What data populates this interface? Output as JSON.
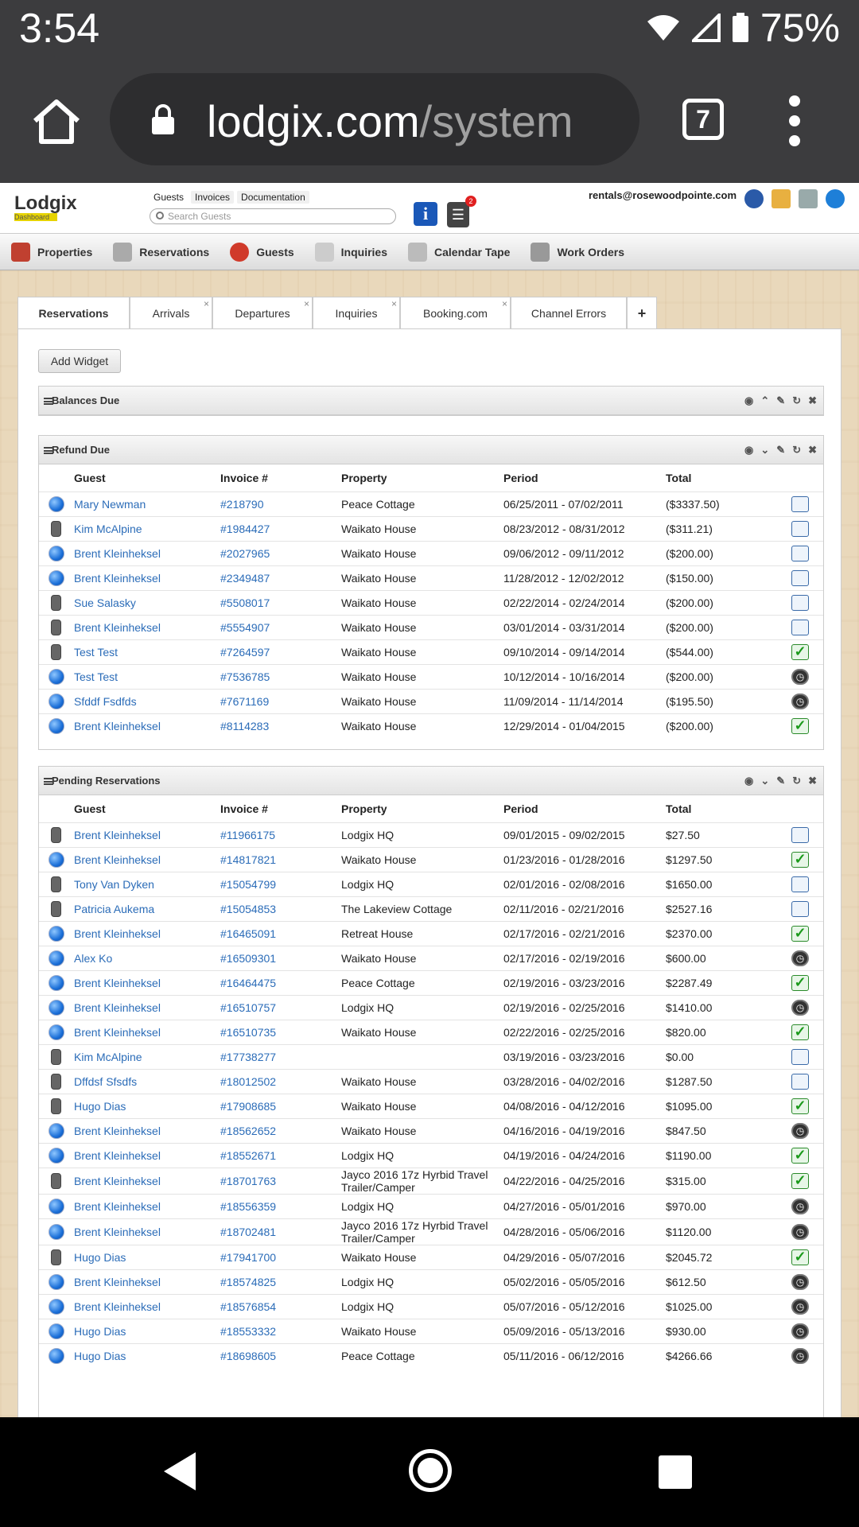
{
  "status": {
    "time": "3:54",
    "battery": "75%"
  },
  "browser": {
    "url_host": "lodgix.com",
    "url_path": "/system",
    "tab_count": "7"
  },
  "header": {
    "logo": "Lodgix",
    "logo_sub": "Dashboard",
    "links": [
      "Guests",
      "Invoices",
      "Documentation"
    ],
    "search_placeholder": "Search Guests",
    "notification_count": "2",
    "email": "rentals@rosewoodpointe.com"
  },
  "nav": [
    "Properties",
    "Reservations",
    "Guests",
    "Inquiries",
    "Calendar Tape",
    "Work Orders"
  ],
  "tabs": [
    "Reservations",
    "Arrivals",
    "Departures",
    "Inquiries",
    "Booking.com",
    "Channel Errors",
    "+"
  ],
  "add_widget": "Add Widget",
  "balances_due": {
    "title": "Balances Due"
  },
  "refund_due": {
    "title": "Refund Due",
    "columns": [
      "Guest",
      "Invoice #",
      "Property",
      "Period",
      "Total"
    ],
    "rows": [
      {
        "device": "globe",
        "guest": "Mary Newman",
        "invoice": "#218790",
        "property": "Peace Cottage",
        "period": "06/25/2011 - 07/02/2011",
        "total": "($3337.50)",
        "action": "edit"
      },
      {
        "device": "phone",
        "guest": "Kim McAlpine",
        "invoice": "#1984427",
        "property": "Waikato House",
        "period": "08/23/2012 - 08/31/2012",
        "total": "($311.21)",
        "action": "edit"
      },
      {
        "device": "globe",
        "guest": "Brent Kleinheksel",
        "invoice": "#2027965",
        "property": "Waikato House",
        "period": "09/06/2012 - 09/11/2012",
        "total": "($200.00)",
        "action": "edit"
      },
      {
        "device": "globe",
        "guest": "Brent Kleinheksel",
        "invoice": "#2349487",
        "property": "Waikato House",
        "period": "11/28/2012 - 12/02/2012",
        "total": "($150.00)",
        "action": "edit"
      },
      {
        "device": "phone",
        "guest": "Sue Salasky",
        "invoice": "#5508017",
        "property": "Waikato House",
        "period": "02/22/2014 - 02/24/2014",
        "total": "($200.00)",
        "action": "edit"
      },
      {
        "device": "phone",
        "guest": "Brent Kleinheksel",
        "invoice": "#5554907",
        "property": "Waikato House",
        "period": "03/01/2014 - 03/31/2014",
        "total": "($200.00)",
        "action": "edit"
      },
      {
        "device": "phone",
        "guest": "Test Test",
        "invoice": "#7264597",
        "property": "Waikato House",
        "period": "09/10/2014 - 09/14/2014",
        "total": "($544.00)",
        "action": "check"
      },
      {
        "device": "globe",
        "guest": "Test Test",
        "invoice": "#7536785",
        "property": "Waikato House",
        "period": "10/12/2014 - 10/16/2014",
        "total": "($200.00)",
        "action": "clock"
      },
      {
        "device": "globe",
        "guest": "Sfddf Fsdfds",
        "invoice": "#7671169",
        "property": "Waikato House",
        "period": "11/09/2014 - 11/14/2014",
        "total": "($195.50)",
        "action": "clock"
      },
      {
        "device": "globe",
        "guest": "Brent Kleinheksel",
        "invoice": "#8114283",
        "property": "Waikato House",
        "period": "12/29/2014 - 01/04/2015",
        "total": "($200.00)",
        "action": "check"
      }
    ]
  },
  "pending": {
    "title": "Pending Reservations",
    "columns": [
      "Guest",
      "Invoice #",
      "Property",
      "Period",
      "Total"
    ],
    "rows": [
      {
        "device": "phone",
        "guest": "Brent Kleinheksel",
        "invoice": "#11966175",
        "property": "Lodgix HQ",
        "period": "09/01/2015 - 09/02/2015",
        "total": "$27.50",
        "action": "edit"
      },
      {
        "device": "globe",
        "guest": "Brent Kleinheksel",
        "invoice": "#14817821",
        "property": "Waikato House",
        "period": "01/23/2016 - 01/28/2016",
        "total": "$1297.50",
        "action": "check"
      },
      {
        "device": "phone",
        "guest": "Tony Van Dyken",
        "invoice": "#15054799",
        "property": "Lodgix HQ",
        "period": "02/01/2016 - 02/08/2016",
        "total": "$1650.00",
        "action": "edit"
      },
      {
        "device": "phone",
        "guest": "Patricia Aukema",
        "invoice": "#15054853",
        "property": "The Lakeview Cottage",
        "period": "02/11/2016 - 02/21/2016",
        "total": "$2527.16",
        "action": "edit"
      },
      {
        "device": "globe",
        "guest": "Brent Kleinheksel",
        "invoice": "#16465091",
        "property": "Retreat House",
        "period": "02/17/2016 - 02/21/2016",
        "total": "$2370.00",
        "action": "check"
      },
      {
        "device": "globe",
        "guest": "Alex Ko",
        "invoice": "#16509301",
        "property": "Waikato House",
        "period": "02/17/2016 - 02/19/2016",
        "total": "$600.00",
        "action": "clock"
      },
      {
        "device": "globe",
        "guest": "Brent Kleinheksel",
        "invoice": "#16464475",
        "property": "Peace Cottage",
        "period": "02/19/2016 - 03/23/2016",
        "total": "$2287.49",
        "action": "check"
      },
      {
        "device": "globe",
        "guest": "Brent Kleinheksel",
        "invoice": "#16510757",
        "property": "Lodgix HQ",
        "period": "02/19/2016 - 02/25/2016",
        "total": "$1410.00",
        "action": "clock"
      },
      {
        "device": "globe",
        "guest": "Brent Kleinheksel",
        "invoice": "#16510735",
        "property": "Waikato House",
        "period": "02/22/2016 - 02/25/2016",
        "total": "$820.00",
        "action": "check"
      },
      {
        "device": "phone",
        "guest": "Kim McAlpine",
        "invoice": "#17738277",
        "property": "",
        "period": "03/19/2016 - 03/23/2016",
        "total": "$0.00",
        "action": "edit"
      },
      {
        "device": "phone",
        "guest": "Dffdsf Sfsdfs",
        "invoice": "#18012502",
        "property": "Waikato House",
        "period": "03/28/2016 - 04/02/2016",
        "total": "$1287.50",
        "action": "edit"
      },
      {
        "device": "phone",
        "guest": "Hugo Dias",
        "invoice": "#17908685",
        "property": "Waikato House",
        "period": "04/08/2016 - 04/12/2016",
        "total": "$1095.00",
        "action": "check"
      },
      {
        "device": "globe",
        "guest": "Brent Kleinheksel",
        "invoice": "#18562652",
        "property": "Waikato House",
        "period": "04/16/2016 - 04/19/2016",
        "total": "$847.50",
        "action": "clock"
      },
      {
        "device": "globe",
        "guest": "Brent Kleinheksel",
        "invoice": "#18552671",
        "property": "Lodgix HQ",
        "period": "04/19/2016 - 04/24/2016",
        "total": "$1190.00",
        "action": "check"
      },
      {
        "device": "phone",
        "guest": "Brent Kleinheksel",
        "invoice": "#18701763",
        "property": "Jayco 2016 17z Hyrbid Travel Trailer/Camper",
        "period": "04/22/2016 - 04/25/2016",
        "total": "$315.00",
        "action": "check"
      },
      {
        "device": "globe",
        "guest": "Brent Kleinheksel",
        "invoice": "#18556359",
        "property": "Lodgix HQ",
        "period": "04/27/2016 - 05/01/2016",
        "total": "$970.00",
        "action": "clock"
      },
      {
        "device": "globe",
        "guest": "Brent Kleinheksel",
        "invoice": "#18702481",
        "property": "Jayco 2016 17z Hyrbid Travel Trailer/Camper",
        "period": "04/28/2016 - 05/06/2016",
        "total": "$1120.00",
        "action": "clock"
      },
      {
        "device": "phone",
        "guest": "Hugo Dias",
        "invoice": "#17941700",
        "property": "Waikato House",
        "period": "04/29/2016 - 05/07/2016",
        "total": "$2045.72",
        "action": "check"
      },
      {
        "device": "globe",
        "guest": "Brent Kleinheksel",
        "invoice": "#18574825",
        "property": "Lodgix HQ",
        "period": "05/02/2016 - 05/05/2016",
        "total": "$612.50",
        "action": "clock"
      },
      {
        "device": "globe",
        "guest": "Brent Kleinheksel",
        "invoice": "#18576854",
        "property": "Lodgix HQ",
        "period": "05/07/2016 - 05/12/2016",
        "total": "$1025.00",
        "action": "clock"
      },
      {
        "device": "globe",
        "guest": "Hugo Dias",
        "invoice": "#18553332",
        "property": "Waikato House",
        "period": "05/09/2016 - 05/13/2016",
        "total": "$930.00",
        "action": "clock"
      },
      {
        "device": "globe",
        "guest": "Hugo Dias",
        "invoice": "#18698605",
        "property": "Peace Cottage",
        "period": "05/11/2016 - 06/12/2016",
        "total": "$4266.66",
        "action": "clock"
      }
    ]
  }
}
